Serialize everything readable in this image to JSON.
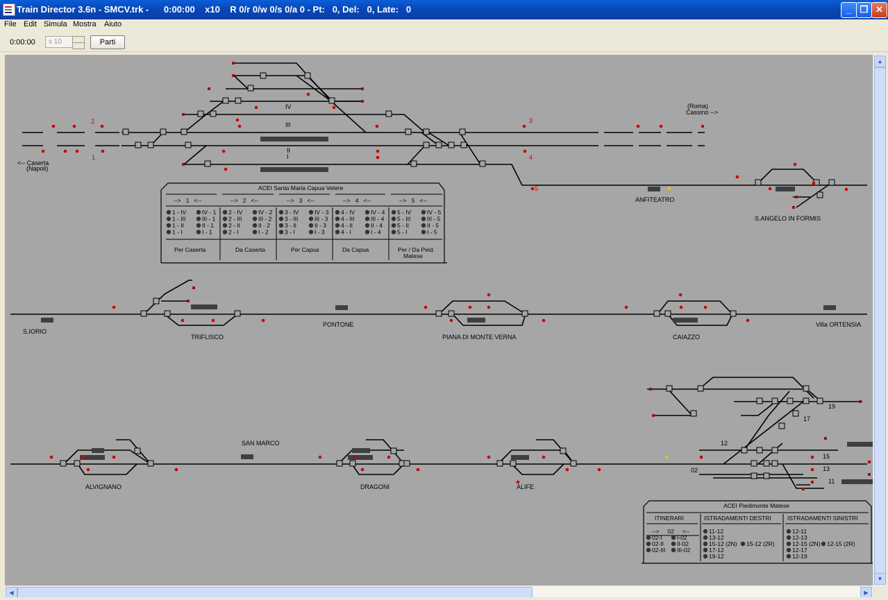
{
  "window": {
    "title": "Train Director 3.6n - SMCV.trk -      0:00:00    x10    R 0/r 0/w 0/s 0/a 0 - Pt:   0, Del:   0, Late:   0",
    "minimize_glyph": "_",
    "maximize_glyph": "❐",
    "close_glyph": "✕"
  },
  "menu": {
    "items": [
      "File",
      "Edit",
      "Simula",
      "Mostra",
      "Aiuto"
    ]
  },
  "toolbar": {
    "clock": "0:00:00",
    "speed": "x 10",
    "start_label": "Parti"
  },
  "colors": {
    "canvas": "#a6a6a6",
    "track": "#000000",
    "signal_red": "#cc0000",
    "signal_yellow": "#e6c200",
    "platform": "#3f3f3f"
  },
  "map": {
    "direction_labels": {
      "caserta": "<-- Caserta",
      "napoli": "(Napoli)",
      "roma": "(Roma)",
      "cassino": "Cassino  -->"
    },
    "signal_numbers": [
      "2",
      "1",
      "3",
      "4",
      "5"
    ],
    "track_numbers": [
      "IV",
      "III",
      "II",
      "I"
    ],
    "stations": [
      "ANFITEATRO",
      "S.ANGELO IN FORMIS",
      "S.IORIO",
      "TRIFLISCO",
      "PONTONE",
      "PIANA DI MONTE VERNA",
      "CAIAZZO",
      "Villa ORTENSIA",
      "SAN MARCO",
      "ALVIGNANO",
      "DRAGONI",
      "ALIFE"
    ],
    "route_numbers": [
      "19",
      "17",
      "12",
      "15",
      "13",
      "11",
      "02"
    ]
  },
  "acei_smcv": {
    "title": "ACEI Santa Maria Capua Vetere",
    "headers": [
      "-->   1   <--",
      "-->   2   <--",
      "-->   3   <--",
      "-->   4   <--",
      "-->   5   <--"
    ],
    "col_left": [
      [
        "1 - IV",
        "1 - III",
        "1 - II",
        "1 - I"
      ],
      [
        "2 - IV",
        "2 - III",
        "2 - II",
        "2 - I"
      ],
      [
        "3 - IV",
        "3 - III",
        "3 - II",
        "3 - I"
      ],
      [
        "4 - IV",
        "4 - III",
        "4 - II",
        "4 - I"
      ],
      [
        "5 - IV",
        "5 - III",
        "5 - II",
        "5 - I"
      ]
    ],
    "col_right": [
      [
        "IV - 1",
        "III - 1",
        "II - 1",
        "I - 1"
      ],
      [
        "IV - 2",
        "III - 2",
        "II - 2",
        "I - 2"
      ],
      [
        "IV - 3",
        "III - 3",
        "II - 3",
        "I - 3"
      ],
      [
        "IV - 4",
        "III - 4",
        "II - 4",
        "I - 4"
      ],
      [
        "IV - 5",
        "III - 5",
        "II - 5",
        "I - 5"
      ]
    ],
    "footers": [
      "Per Caserta",
      "Da Caserta",
      "Per Capua",
      "Da Capua",
      "Per / Da Peid.",
      "Matese"
    ]
  },
  "acei_pm": {
    "title": "ACEI Piedimonte Matese",
    "headers": [
      "ITINERARI",
      "ISTRADAMENTI DESTRI",
      "ISTRADAMENTI SINISTRI"
    ],
    "itin_header": "-->     02     <--",
    "itin_left": [
      "02-I",
      "02-II",
      "02-III"
    ],
    "itin_right": [
      "I-02",
      "II-02",
      "III-02"
    ],
    "destri": [
      "11-12",
      "13-12",
      "15-12 (2N)",
      "17-12",
      "19-12"
    ],
    "destri_extra": "15-12 (2R)",
    "sinistri": [
      "12-11",
      "12-13",
      "12-15 (2N)",
      "12-17",
      "12-19"
    ],
    "sinistri_extra": "12-15 (2R)"
  },
  "scroll": {
    "up": "▲",
    "down": "▼",
    "left": "◀",
    "right": "▶"
  }
}
